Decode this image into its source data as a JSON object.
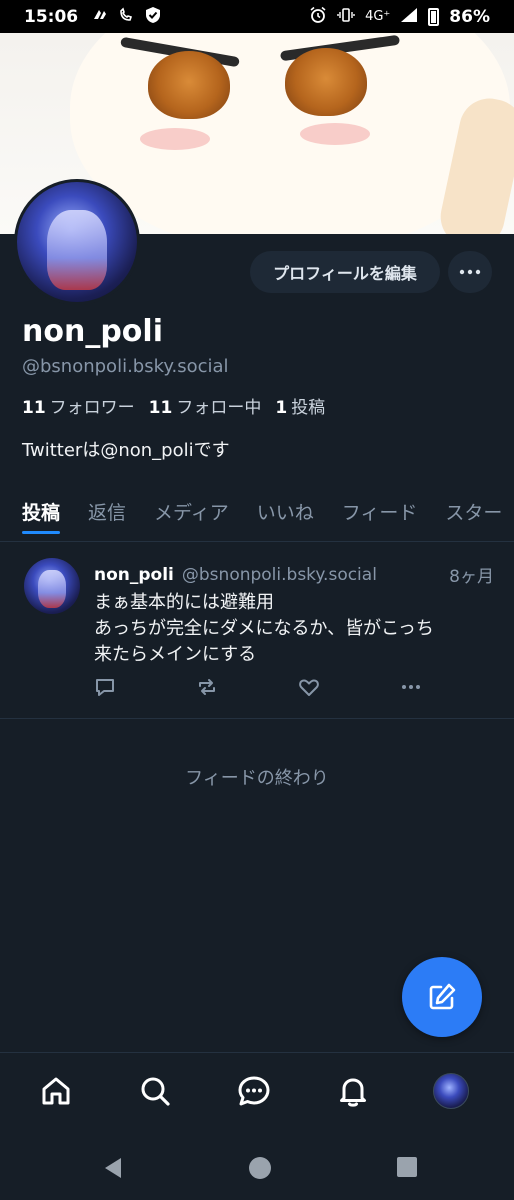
{
  "status_bar": {
    "time": "15:06",
    "network": "4G⁺",
    "battery": "86%"
  },
  "profile": {
    "display_name": "non_poli",
    "handle": "@bsnonpoli.bsky.social",
    "edit_button": "プロフィールを編集",
    "more_button": "•••",
    "followers_count": "11",
    "followers_label": "フォロワー",
    "following_count": "11",
    "following_label": "フォロー中",
    "posts_count": "1",
    "posts_label": "投稿",
    "bio": "Twitterは@non_poliです"
  },
  "tabs": [
    {
      "label": "投稿",
      "active": true
    },
    {
      "label": "返信",
      "active": false
    },
    {
      "label": "メディア",
      "active": false
    },
    {
      "label": "いいね",
      "active": false
    },
    {
      "label": "フィード",
      "active": false
    },
    {
      "label": "スター",
      "active": false
    }
  ],
  "posts": [
    {
      "author_name": "non_poli",
      "author_handle": "@bsnonpoli.bsky.social",
      "time": "8ヶ月",
      "text_line1": "まぁ基本的には避難用",
      "text_line2": "あっちが完全にダメになるか、皆がこっち",
      "text_line3": "来たらメインにする"
    }
  ],
  "feed_end": "フィードの終わり",
  "bottom_nav": [
    "home-icon",
    "search-icon",
    "chat-icon",
    "bell-icon",
    "profile-avatar"
  ],
  "colors": {
    "background": "#161e27",
    "accent": "#208bfe",
    "fab": "#2c7cf6",
    "muted_text": "#8796a8"
  }
}
